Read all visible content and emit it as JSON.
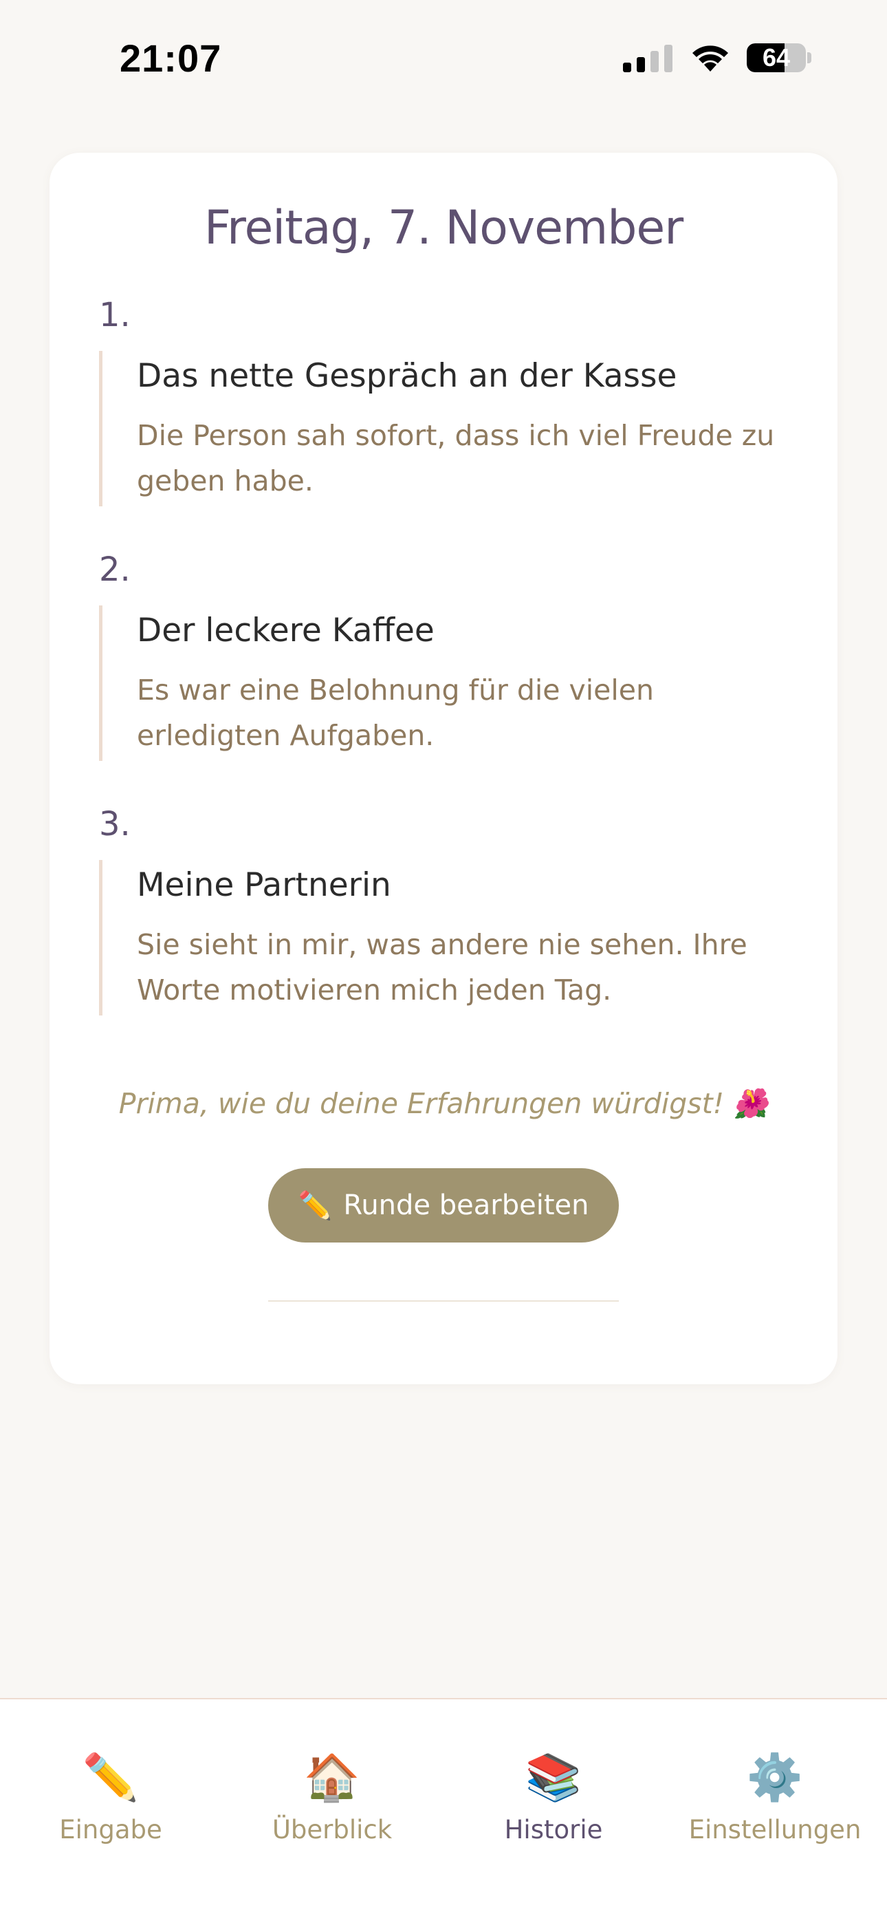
{
  "status_bar": {
    "time": "21:07",
    "battery_level": "64",
    "battery_fill_fraction": 0.64
  },
  "card": {
    "date_title": "Freitag, 7. November",
    "entries": [
      {
        "number": "1.",
        "title": "Das nette Gespräch an der Kasse",
        "text": "Die Person sah sofort, dass ich viel Freude zu geben habe."
      },
      {
        "number": "2.",
        "title": "Der leckere Kaffee",
        "text": "Es war eine Belohnung für die vielen erledigten Aufgaben."
      },
      {
        "number": "3.",
        "title": "Meine Partnerin",
        "text": "Sie sieht in mir, was andere nie sehen. Ihre Worte motivieren mich jeden Tag."
      }
    ],
    "praise": "Prima, wie du deine Erfahrungen würdigst! 🌺",
    "edit_button": {
      "icon": "✏️",
      "label": "Runde bearbeiten"
    }
  },
  "tabs": [
    {
      "label": "Eingabe",
      "icon": "✏️",
      "active": false
    },
    {
      "label": "Überblick",
      "icon": "🏠",
      "active": false
    },
    {
      "label": "Historie",
      "icon": "📚",
      "active": true
    },
    {
      "label": "Einstellungen",
      "icon": "⚙️",
      "active": false
    }
  ],
  "colors": {
    "background": "#f9f7f4",
    "title": "#5e5170",
    "accent_text": "#8f7a5e",
    "button": "#a09470",
    "praise": "#a99a72",
    "tab_inactive": "#a99a72",
    "tab_active": "#5e5170"
  }
}
